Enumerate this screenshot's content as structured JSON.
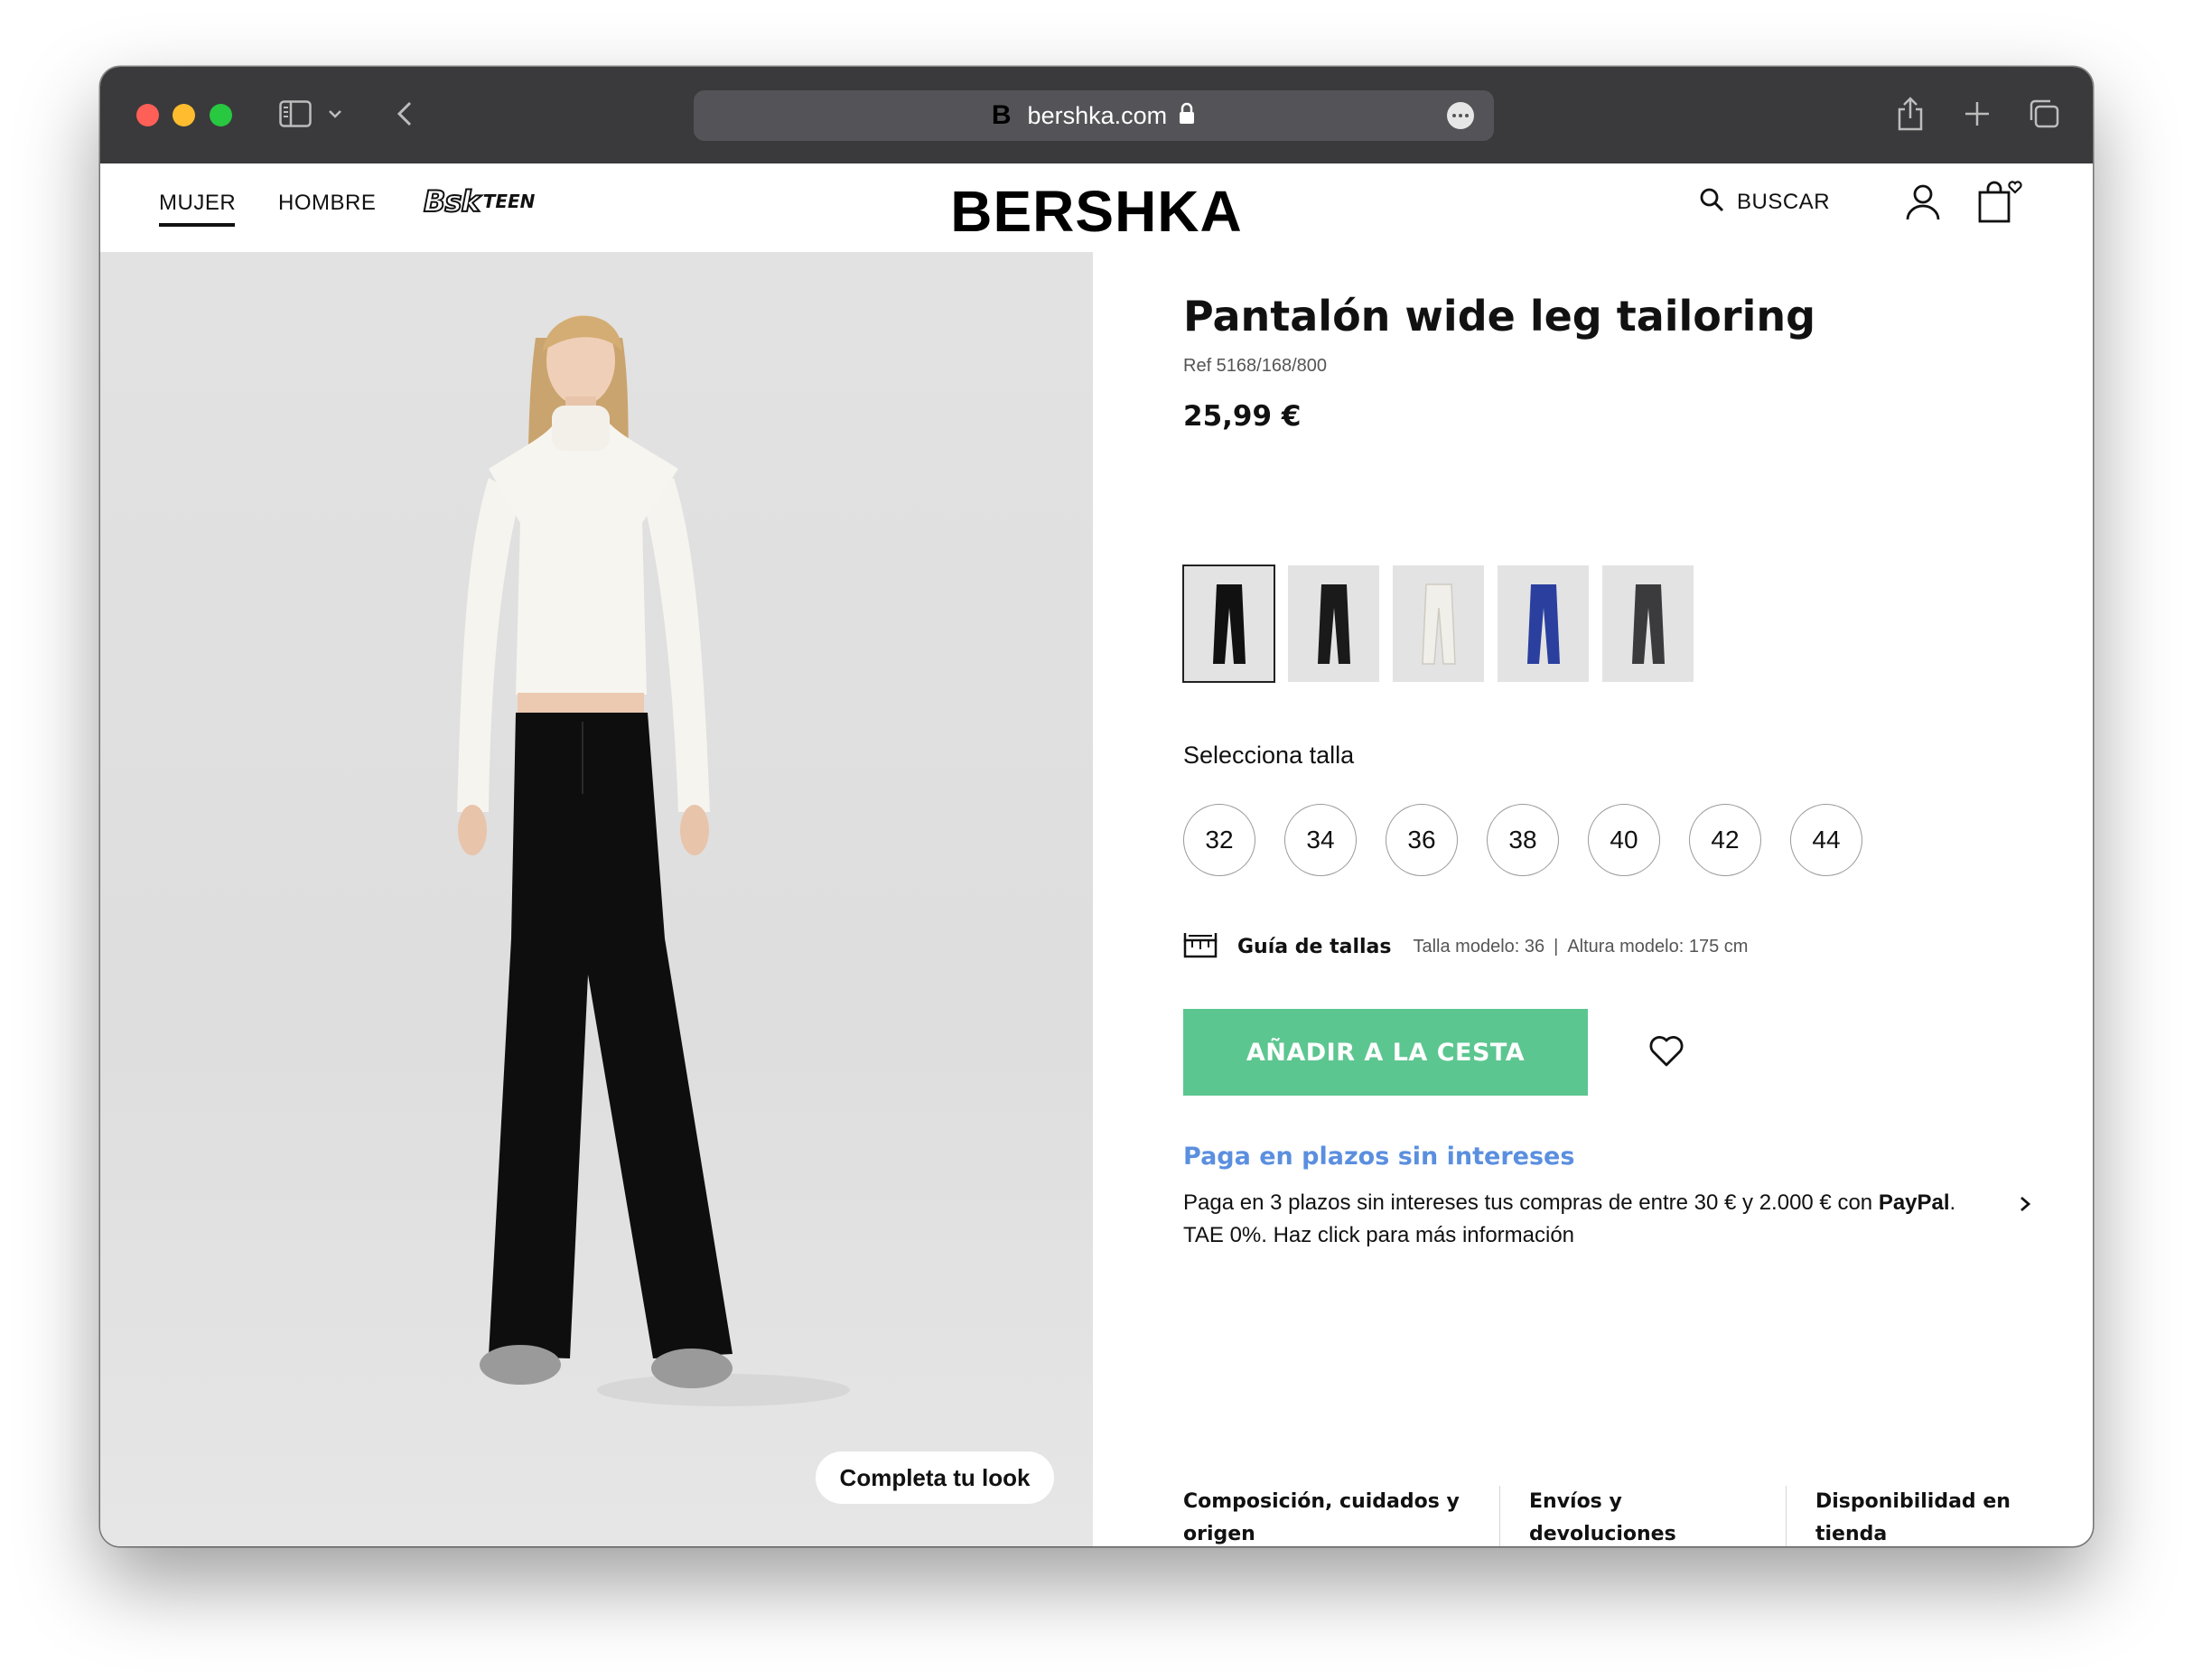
{
  "browser": {
    "url": "bershka.com",
    "favicon_letter": "B"
  },
  "header": {
    "nav": [
      "MUJER",
      "HOMBRE"
    ],
    "teen_logo_bsk": "Bsk",
    "teen_logo_word": "TEEN",
    "brand": "BERSHKA",
    "search_label": "BUSCAR"
  },
  "product": {
    "title": "Pantalón wide leg tailoring",
    "ref": "Ref 5168/168/800",
    "price": "25,99 €",
    "colors": [
      {
        "name": "black",
        "hex": "#111111",
        "selected": true
      },
      {
        "name": "black-2",
        "hex": "#1a1a1a",
        "selected": false
      },
      {
        "name": "ecru",
        "hex": "#f1efe9",
        "selected": false
      },
      {
        "name": "blue",
        "hex": "#2b3f9e",
        "selected": false
      },
      {
        "name": "grey",
        "hex": "#3b3b3e",
        "selected": false
      }
    ],
    "size_heading": "Selecciona talla",
    "sizes": [
      "32",
      "34",
      "36",
      "38",
      "40",
      "42",
      "44"
    ],
    "size_guide_label": "Guía de tallas",
    "model_size": "Talla modelo: 36",
    "model_separator": "|",
    "model_height": "Altura modelo: 175 cm",
    "add_to_cart_label": "AÑADIR A LA CESTA",
    "add_to_cart_color": "#5cc690",
    "complete_look_label": "Completa tu look"
  },
  "installments": {
    "title": "Paga en plazos sin intereses",
    "text_before": "Paga en 3 plazos sin intereses tus compras de entre 30 € y 2.000 € con ",
    "text_brand": "PayPal",
    "text_after": ".",
    "text_line2": "TAE 0%. Haz click para más información",
    "link_color": "#5b8fdf"
  },
  "bottom_links": [
    {
      "line1": "Composición, cuidados y",
      "line2": "origen"
    },
    {
      "line1": "Envíos y",
      "line2": "devoluciones"
    },
    {
      "line1": "Disponibilidad en",
      "line2": "tienda"
    }
  ]
}
